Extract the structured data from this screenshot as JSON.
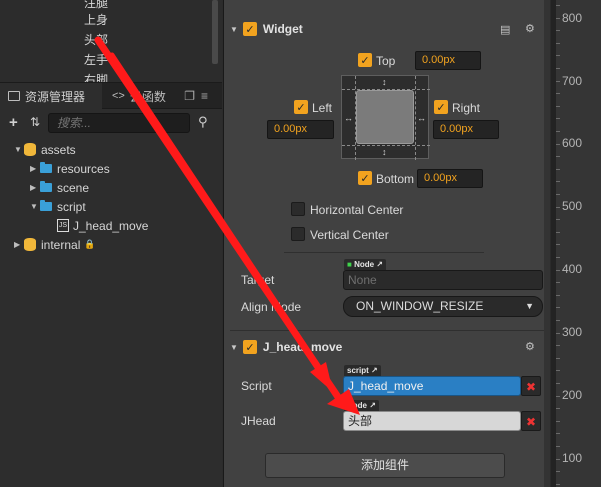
{
  "hierarchy": {
    "nodes": [
      "注腿",
      "上身",
      "头部",
      "左手",
      "右脚"
    ]
  },
  "assets_panel": {
    "tab_assets": "资源管理器",
    "tab_cloud": "云函数",
    "search_placeholder": "搜索...",
    "tree": {
      "assets": "assets",
      "resources": "resources",
      "scene": "scene",
      "script": "script",
      "j_head_move_file": "J_head_move",
      "internal": "internal",
      "js_badge": "JS"
    }
  },
  "widget": {
    "title": "Widget",
    "top_label": "Top",
    "top_value": "0.00px",
    "left_label": "Left",
    "left_value": "0.00px",
    "right_label": "Right",
    "right_value": "0.00px",
    "bottom_label": "Bottom",
    "bottom_value": "0.00px",
    "horizontal_center": "Horizontal Center",
    "vertical_center": "Vertical Center",
    "target_label": "Target",
    "target_tag": "Node",
    "target_value": "None",
    "align_mode_label": "Align Mode",
    "align_mode_value": "ON_WINDOW_RESIZE"
  },
  "jhead_component": {
    "title": "J_head_move",
    "script_label": "Script",
    "script_tag": "script",
    "script_value": "J_head_move",
    "jhead_label": "JHead",
    "jhead_tag": "Node",
    "jhead_value": "头部"
  },
  "add_component_button": "添加组件",
  "ruler": {
    "labels": [
      "800",
      "700",
      "600",
      "500",
      "400",
      "300",
      "200",
      "100"
    ]
  },
  "colors": {
    "accent": "#f2a31f",
    "selected_field": "#2a7fc4",
    "clear_red": "#e33333",
    "arrow_red": "#ff1a1a"
  }
}
